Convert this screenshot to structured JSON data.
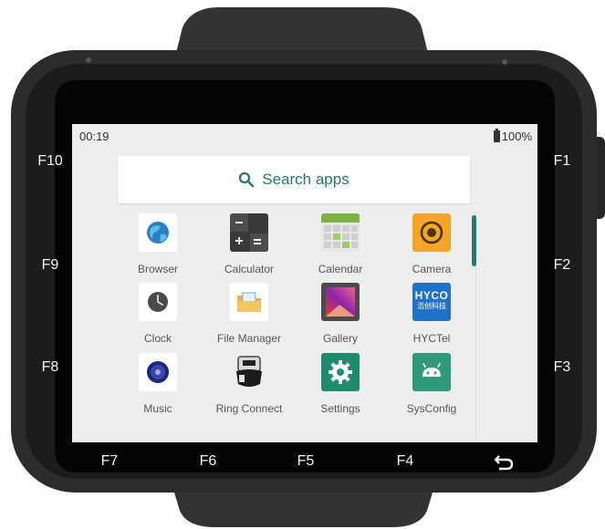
{
  "status_bar": {
    "time": "00:19",
    "battery": "100%"
  },
  "search": {
    "placeholder": "Search apps"
  },
  "function_keys": {
    "left": [
      "F10",
      "F9",
      "F8"
    ],
    "right": [
      "F1",
      "F2",
      "F3"
    ],
    "bottom": [
      "F7",
      "F6",
      "F5",
      "F4"
    ],
    "back_icon": "back-arrow-icon"
  },
  "apps": [
    {
      "label": "Browser",
      "icon": "browser-icon"
    },
    {
      "label": "Calculator",
      "icon": "calculator-icon"
    },
    {
      "label": "Calendar",
      "icon": "calendar-icon"
    },
    {
      "label": "Camera",
      "icon": "camera-icon"
    },
    {
      "label": "Clock",
      "icon": "clock-icon"
    },
    {
      "label": "File Manager",
      "icon": "file-manager-icon"
    },
    {
      "label": "Gallery",
      "icon": "gallery-icon"
    },
    {
      "label": "HYCTel",
      "icon": "hyctel-icon",
      "icon_text": [
        "HYCO",
        "浩创科技"
      ]
    },
    {
      "label": "Music",
      "icon": "music-icon"
    },
    {
      "label": "Ring Connect",
      "icon": "ring-connect-icon"
    },
    {
      "label": "Settings",
      "icon": "settings-icon"
    },
    {
      "label": "SysConfig",
      "icon": "sysconfig-icon"
    }
  ],
  "colors": {
    "accent": "#1b7f6f",
    "device_body": "#2b2b2b",
    "screen_bg": "#eeeeee"
  }
}
